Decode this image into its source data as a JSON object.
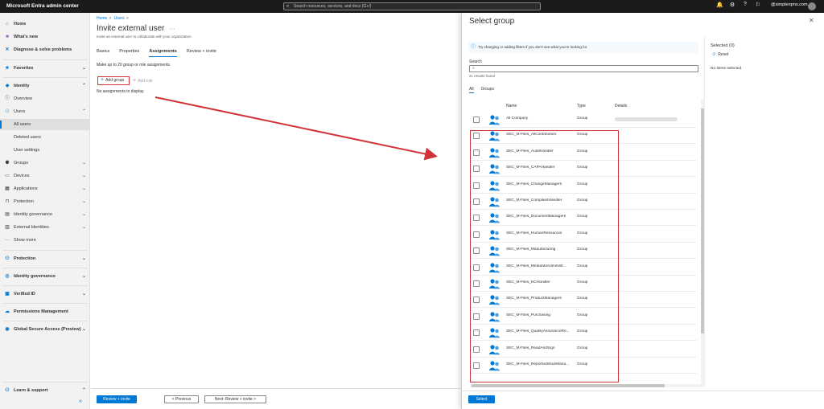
{
  "topbar": {
    "brand": "Microsoft Entra admin center",
    "search_placeholder": "Search resources, services, and docs (G+/)",
    "user": "@simplerqms.com"
  },
  "nav": {
    "items": [
      {
        "label": "Home",
        "icon": "home-icon"
      },
      {
        "label": "What's new",
        "icon": "whats-new-icon"
      },
      {
        "label": "Diagnose & solve problems",
        "icon": "diagnose-icon"
      },
      {
        "label": "Favorites",
        "icon": "star-icon"
      },
      {
        "label": "Identity",
        "icon": "identity-icon"
      },
      {
        "label": "Overview",
        "icon": "info-icon"
      },
      {
        "label": "Users",
        "icon": "user-icon"
      },
      {
        "label": "All users"
      },
      {
        "label": "Deleted users"
      },
      {
        "label": "User settings"
      },
      {
        "label": "Groups",
        "icon": "groups-icon"
      },
      {
        "label": "Devices",
        "icon": "devices-icon"
      },
      {
        "label": "Applications",
        "icon": "apps-icon"
      },
      {
        "label": "Protection",
        "icon": "lock-icon"
      },
      {
        "label": "Identity governance",
        "icon": "governance-icon"
      },
      {
        "label": "External Identities",
        "icon": "external-icon"
      },
      {
        "label": "Show more",
        "icon": "more-icon"
      },
      {
        "label": "Protection",
        "icon": "protection-icon"
      },
      {
        "label": "Identity governance",
        "icon": "governance-icon"
      },
      {
        "label": "Verified ID",
        "icon": "verified-icon"
      },
      {
        "label": "Permissions Management",
        "icon": "permissions-icon"
      },
      {
        "label": "Global Secure Access (Preview)",
        "icon": "globe-icon"
      },
      {
        "label": "Learn & support",
        "icon": "learn-icon"
      }
    ],
    "collapse": "«"
  },
  "main": {
    "breadcrumb": [
      "Home",
      "Users"
    ],
    "title": "Invite external user",
    "more": "···",
    "subtitle": "Invite an external user to collaborate with your organization",
    "tabs": [
      "Basics",
      "Properties",
      "Assignments",
      "Review + invite"
    ],
    "description": "Make up to 20 group or role assignments.",
    "add_group": "Add group",
    "add_role": "Add role",
    "no_assignments": "No assignments to display.",
    "review_button": "Review + invite",
    "previous_button": "< Previous",
    "next_button": "Next: Review + invite >"
  },
  "panel": {
    "title": "Select group",
    "info": "Try changing or adding filters if you don't see what you're looking for.",
    "search_label": "Search",
    "search_value": "",
    "results": "21 results found",
    "tabs": [
      "All",
      "Groups"
    ],
    "columns": [
      "Name",
      "Type",
      "Details"
    ],
    "rows": [
      {
        "name": "All Company",
        "type": "Group"
      },
      {
        "name": "SEC_M-Files_AllContributors",
        "type": "Group"
      },
      {
        "name": "SEC_M-Files_AuditHandler",
        "type": "Group"
      },
      {
        "name": "SEC_M-Files_CAPAHandler",
        "type": "Group"
      },
      {
        "name": "SEC_M-Files_ChangeManagers",
        "type": "Group"
      },
      {
        "name": "SEC_M-Files_ComplaintHandler",
        "type": "Group"
      },
      {
        "name": "SEC_M-Files_DocumentManagers",
        "type": "Group"
      },
      {
        "name": "SEC_M-Files_HumanResources",
        "type": "Group"
      },
      {
        "name": "SEC_M-Files_Manufacturing",
        "type": "Group"
      },
      {
        "name": "SEC_M-Files_MetadataAdministr...",
        "type": "Group"
      },
      {
        "name": "SEC_M-Files_NCHandler",
        "type": "Group"
      },
      {
        "name": "SEC_M-Files_ProductManagers",
        "type": "Group"
      },
      {
        "name": "SEC_M-Files_Purchasing",
        "type": "Group"
      },
      {
        "name": "SEC_M-Files_QualityAssuranceRe...",
        "type": "Group"
      },
      {
        "name": "SEC_M-Files_ReadAndSign",
        "type": "Group"
      },
      {
        "name": "SEC_M-Files_ReportedIssueMana...",
        "type": "Group"
      }
    ],
    "selected_header": "Selected (0)",
    "reset": "Reset",
    "no_items": "No items selected",
    "select_button": "Select"
  },
  "colors": {
    "accent": "#0078d4",
    "highlight": "#d13438"
  }
}
